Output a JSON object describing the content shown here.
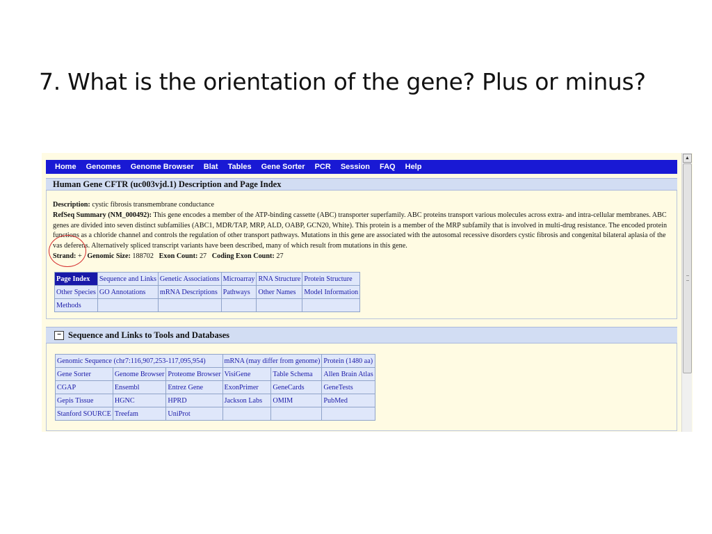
{
  "slide": {
    "title": "7. What is the orientation of the gene? Plus or minus?"
  },
  "nav": {
    "items": [
      "Home",
      "Genomes",
      "Genome Browser",
      "Blat",
      "Tables",
      "Gene Sorter",
      "PCR",
      "Session",
      "FAQ",
      "Help"
    ]
  },
  "gene": {
    "header": "Human Gene CFTR (uc003vjd.1) Description and Page Index",
    "description_label": "Description:",
    "description": "cystic fibrosis transmembrane conductance",
    "refseq_label": "RefSeq Summary (NM_000492):",
    "refseq_summary": "This gene encodes a member of the ATP-binding cassette (ABC) transporter superfamily. ABC proteins transport various molecules across extra- and intra-cellular membranes. ABC genes are divided into seven distinct subfamilies (ABC1, MDR/TAP, MRP, ALD, OABP, GCN20, White). This protein is a member of the MRP subfamily that is involved in multi-drug resistance. The encoded protein functions as a chloride channel and controls the regulation of other transport pathways. Mutations in this gene are associated with the autosomal recessive disorders cystic fibrosis and congenital bilateral aplasia of the vas deferens. Alternatively spliced transcript variants have been described, many of which result from mutations in this gene.",
    "strand_label": "Strand:",
    "strand": "+",
    "genomic_size_label": "Genomic Size:",
    "genomic_size": "188702",
    "exon_count_label": "Exon Count:",
    "exon_count": "27",
    "coding_exon_count_label": "Coding Exon Count:",
    "coding_exon_count": "27"
  },
  "page_index": {
    "rows": [
      [
        "Page Index",
        "Sequence and Links",
        "Genetic Associations",
        "Microarray",
        "RNA Structure",
        "Protein Structure"
      ],
      [
        "Other Species",
        "GO Annotations",
        "mRNA Descriptions",
        "Pathways",
        "Other Names",
        "Model Information"
      ],
      [
        "Methods",
        "",
        "",
        "",
        "",
        ""
      ]
    ]
  },
  "sequence_links": {
    "header": "Sequence and Links to Tools and Databases",
    "collapse_symbol": "−",
    "row0": [
      "Genomic Sequence (chr7:116,907,253-117,095,954)",
      "mRNA (may differ from genome)",
      "Protein (1480 aa)"
    ],
    "rows": [
      [
        "Gene Sorter",
        "Genome Browser",
        "Proteome Browser",
        "VisiGene",
        "Table Schema",
        "Allen Brain Atlas"
      ],
      [
        "CGAP",
        "Ensembl",
        "Entrez Gene",
        "ExonPrimer",
        "GeneCards",
        "GeneTests"
      ],
      [
        "Gepis Tissue",
        "HGNC",
        "HPRD",
        "Jackson Labs",
        "OMIM",
        "PubMed"
      ],
      [
        "Stanford SOURCE",
        "Treefam",
        "UniProt",
        "",
        "",
        ""
      ]
    ]
  },
  "scrollbar": {
    "up_arrow": "▲"
  }
}
